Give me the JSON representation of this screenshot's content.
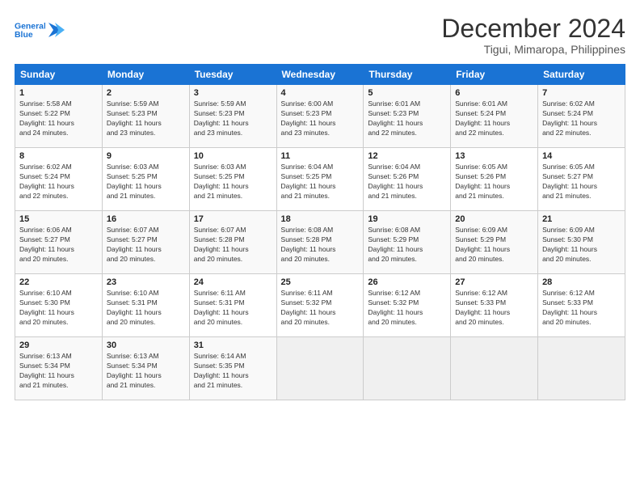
{
  "logo": {
    "line1": "General",
    "line2": "Blue"
  },
  "title": "December 2024",
  "location": "Tigui, Mimaropa, Philippines",
  "days_header": [
    "Sunday",
    "Monday",
    "Tuesday",
    "Wednesday",
    "Thursday",
    "Friday",
    "Saturday"
  ],
  "weeks": [
    [
      {
        "day": "1",
        "info": "Sunrise: 5:58 AM\nSunset: 5:22 PM\nDaylight: 11 hours\nand 24 minutes."
      },
      {
        "day": "2",
        "info": "Sunrise: 5:59 AM\nSunset: 5:23 PM\nDaylight: 11 hours\nand 23 minutes."
      },
      {
        "day": "3",
        "info": "Sunrise: 5:59 AM\nSunset: 5:23 PM\nDaylight: 11 hours\nand 23 minutes."
      },
      {
        "day": "4",
        "info": "Sunrise: 6:00 AM\nSunset: 5:23 PM\nDaylight: 11 hours\nand 23 minutes."
      },
      {
        "day": "5",
        "info": "Sunrise: 6:01 AM\nSunset: 5:23 PM\nDaylight: 11 hours\nand 22 minutes."
      },
      {
        "day": "6",
        "info": "Sunrise: 6:01 AM\nSunset: 5:24 PM\nDaylight: 11 hours\nand 22 minutes."
      },
      {
        "day": "7",
        "info": "Sunrise: 6:02 AM\nSunset: 5:24 PM\nDaylight: 11 hours\nand 22 minutes."
      }
    ],
    [
      {
        "day": "8",
        "info": "Sunrise: 6:02 AM\nSunset: 5:24 PM\nDaylight: 11 hours\nand 22 minutes."
      },
      {
        "day": "9",
        "info": "Sunrise: 6:03 AM\nSunset: 5:25 PM\nDaylight: 11 hours\nand 21 minutes."
      },
      {
        "day": "10",
        "info": "Sunrise: 6:03 AM\nSunset: 5:25 PM\nDaylight: 11 hours\nand 21 minutes."
      },
      {
        "day": "11",
        "info": "Sunrise: 6:04 AM\nSunset: 5:25 PM\nDaylight: 11 hours\nand 21 minutes."
      },
      {
        "day": "12",
        "info": "Sunrise: 6:04 AM\nSunset: 5:26 PM\nDaylight: 11 hours\nand 21 minutes."
      },
      {
        "day": "13",
        "info": "Sunrise: 6:05 AM\nSunset: 5:26 PM\nDaylight: 11 hours\nand 21 minutes."
      },
      {
        "day": "14",
        "info": "Sunrise: 6:05 AM\nSunset: 5:27 PM\nDaylight: 11 hours\nand 21 minutes."
      }
    ],
    [
      {
        "day": "15",
        "info": "Sunrise: 6:06 AM\nSunset: 5:27 PM\nDaylight: 11 hours\nand 20 minutes."
      },
      {
        "day": "16",
        "info": "Sunrise: 6:07 AM\nSunset: 5:27 PM\nDaylight: 11 hours\nand 20 minutes."
      },
      {
        "day": "17",
        "info": "Sunrise: 6:07 AM\nSunset: 5:28 PM\nDaylight: 11 hours\nand 20 minutes."
      },
      {
        "day": "18",
        "info": "Sunrise: 6:08 AM\nSunset: 5:28 PM\nDaylight: 11 hours\nand 20 minutes."
      },
      {
        "day": "19",
        "info": "Sunrise: 6:08 AM\nSunset: 5:29 PM\nDaylight: 11 hours\nand 20 minutes."
      },
      {
        "day": "20",
        "info": "Sunrise: 6:09 AM\nSunset: 5:29 PM\nDaylight: 11 hours\nand 20 minutes."
      },
      {
        "day": "21",
        "info": "Sunrise: 6:09 AM\nSunset: 5:30 PM\nDaylight: 11 hours\nand 20 minutes."
      }
    ],
    [
      {
        "day": "22",
        "info": "Sunrise: 6:10 AM\nSunset: 5:30 PM\nDaylight: 11 hours\nand 20 minutes."
      },
      {
        "day": "23",
        "info": "Sunrise: 6:10 AM\nSunset: 5:31 PM\nDaylight: 11 hours\nand 20 minutes."
      },
      {
        "day": "24",
        "info": "Sunrise: 6:11 AM\nSunset: 5:31 PM\nDaylight: 11 hours\nand 20 minutes."
      },
      {
        "day": "25",
        "info": "Sunrise: 6:11 AM\nSunset: 5:32 PM\nDaylight: 11 hours\nand 20 minutes."
      },
      {
        "day": "26",
        "info": "Sunrise: 6:12 AM\nSunset: 5:32 PM\nDaylight: 11 hours\nand 20 minutes."
      },
      {
        "day": "27",
        "info": "Sunrise: 6:12 AM\nSunset: 5:33 PM\nDaylight: 11 hours\nand 20 minutes."
      },
      {
        "day": "28",
        "info": "Sunrise: 6:12 AM\nSunset: 5:33 PM\nDaylight: 11 hours\nand 20 minutes."
      }
    ],
    [
      {
        "day": "29",
        "info": "Sunrise: 6:13 AM\nSunset: 5:34 PM\nDaylight: 11 hours\nand 21 minutes."
      },
      {
        "day": "30",
        "info": "Sunrise: 6:13 AM\nSunset: 5:34 PM\nDaylight: 11 hours\nand 21 minutes."
      },
      {
        "day": "31",
        "info": "Sunrise: 6:14 AM\nSunset: 5:35 PM\nDaylight: 11 hours\nand 21 minutes."
      },
      {
        "day": "",
        "info": ""
      },
      {
        "day": "",
        "info": ""
      },
      {
        "day": "",
        "info": ""
      },
      {
        "day": "",
        "info": ""
      }
    ]
  ]
}
